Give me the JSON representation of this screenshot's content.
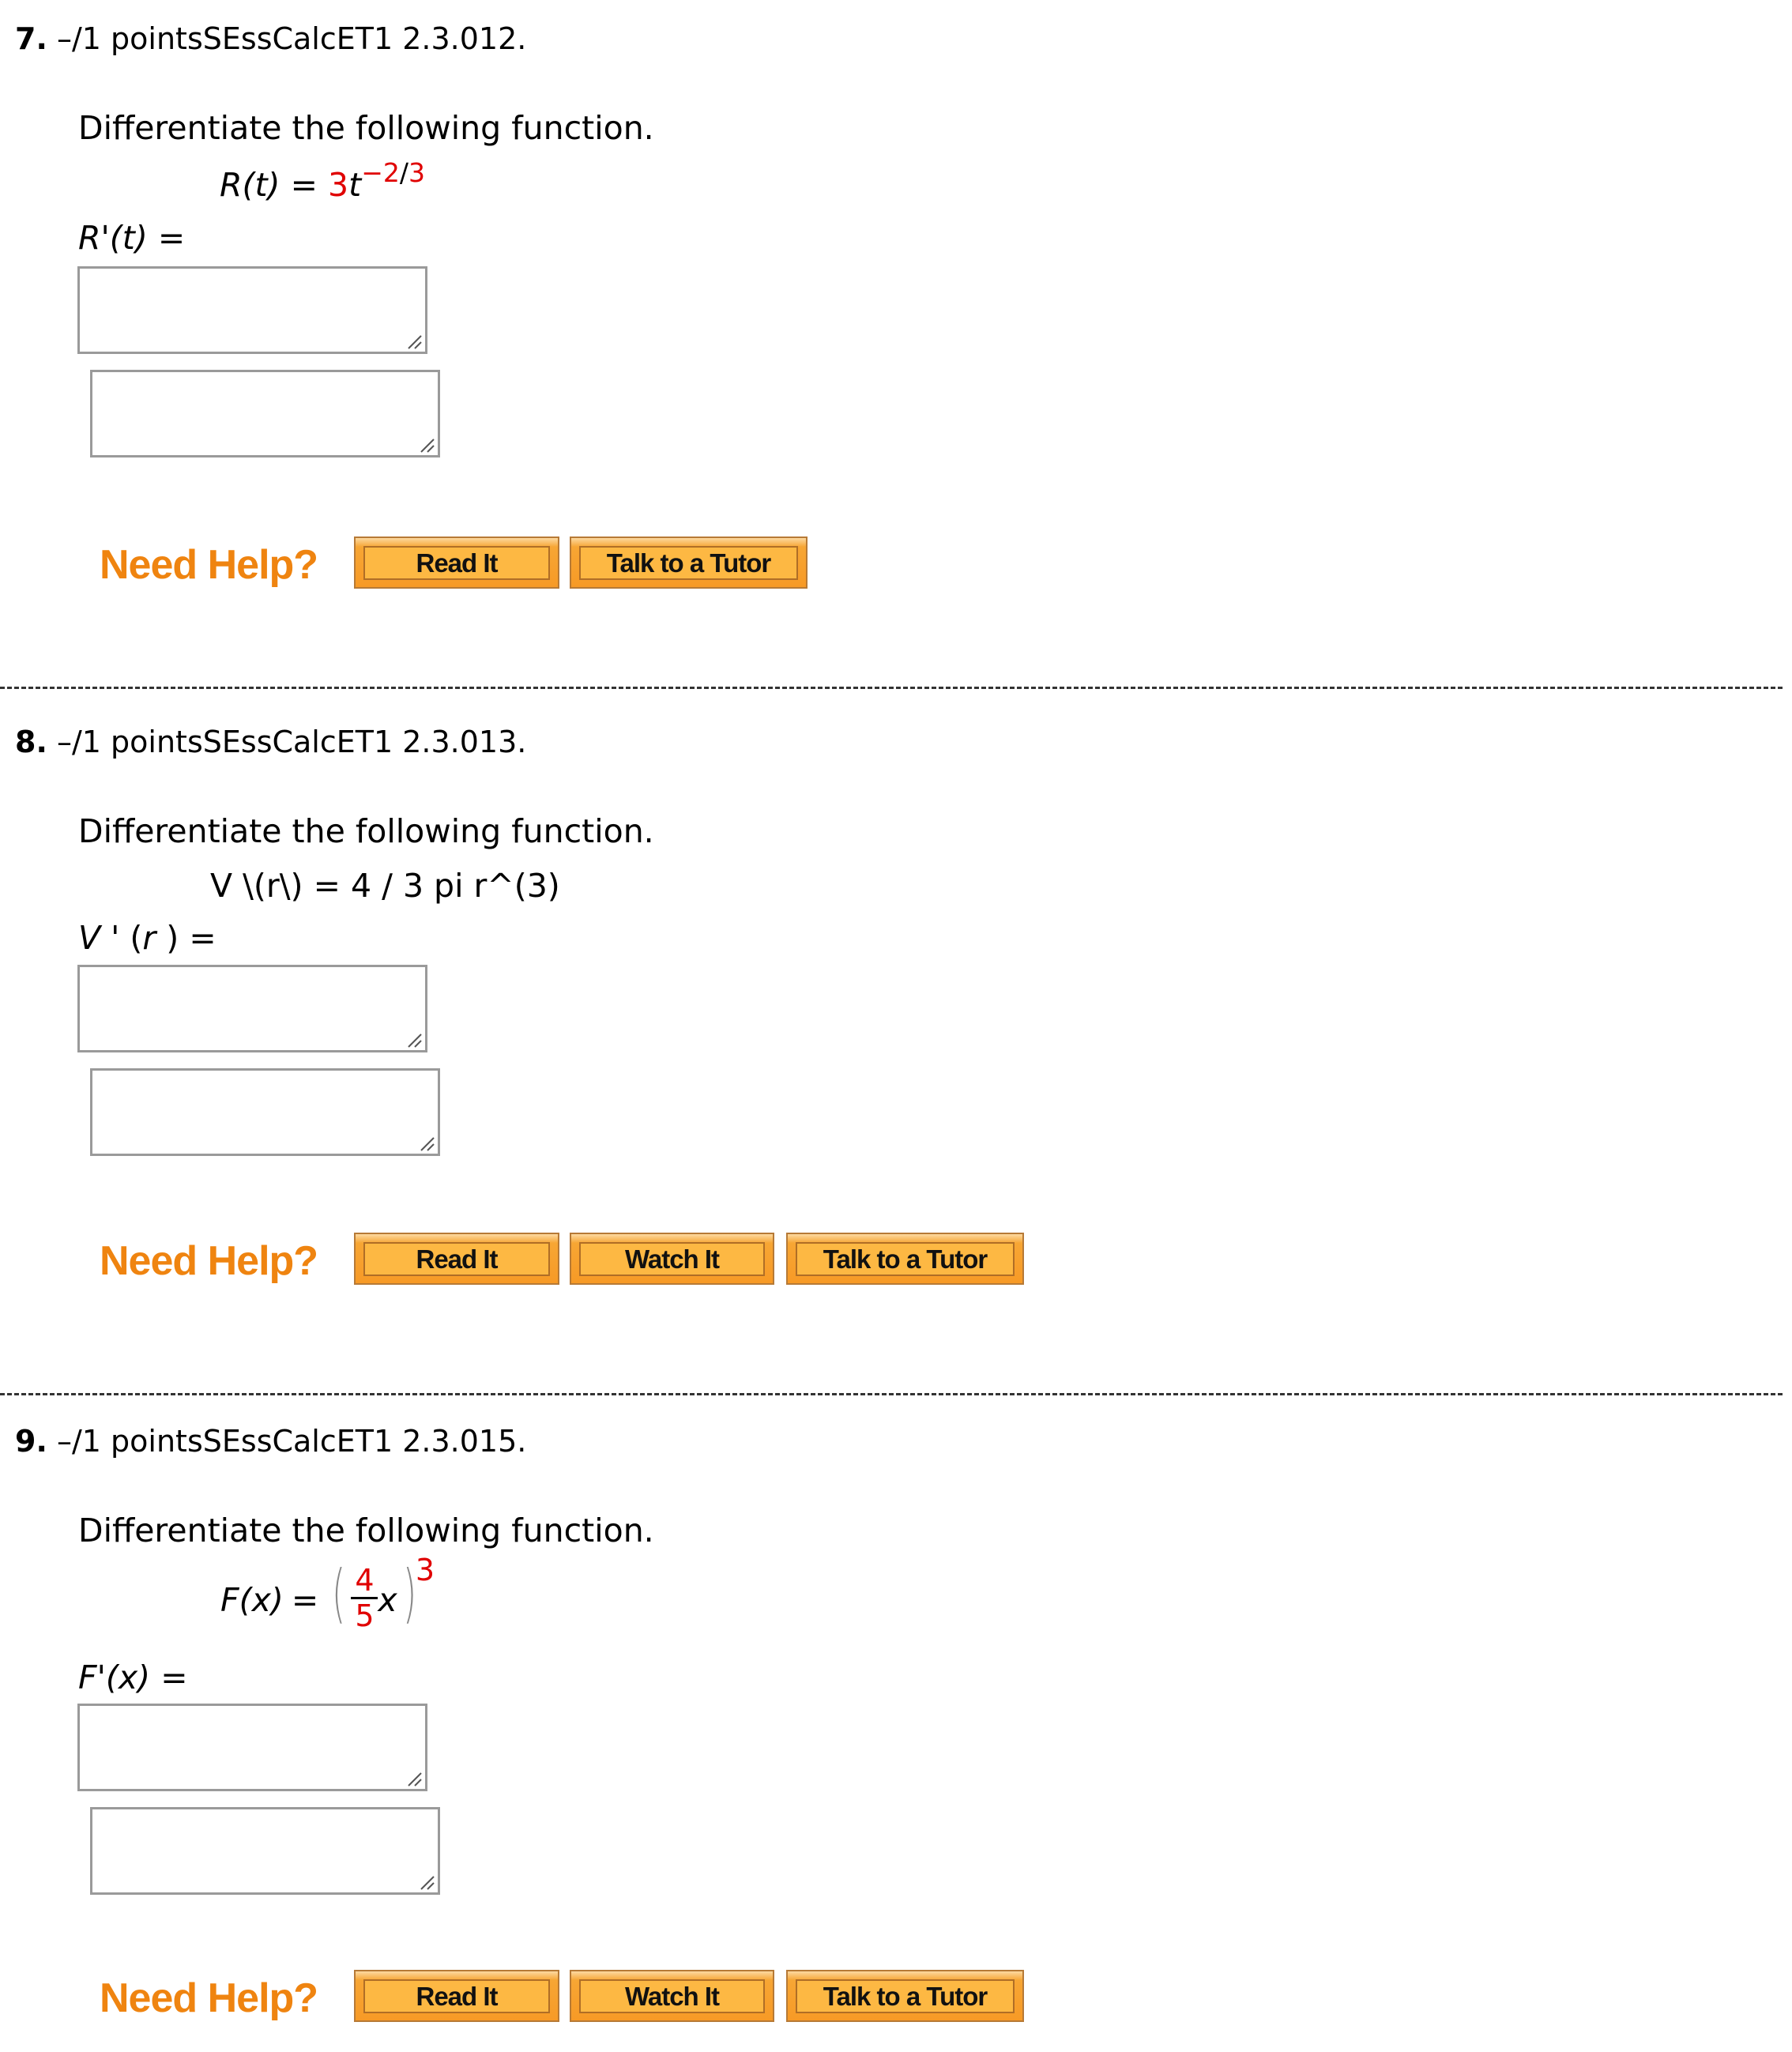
{
  "questions": [
    {
      "number": "7.",
      "points": "–/1 points",
      "code": "SEssCalcET1 2.3.012.",
      "instruction": "Differentiate the following function.",
      "function": {
        "lhs": "R(t)",
        "eq": "=",
        "coef": "3",
        "var": "t",
        "exp_sign": "−",
        "exp_num": "2",
        "exp_slash": "/",
        "exp_den": "3"
      },
      "answer_label": {
        "name": "R",
        "prime": "'",
        "arg": "(t)",
        "eq": "="
      },
      "answer_value": "",
      "work_value": "",
      "help_label": "Need Help?",
      "buttons": [
        "Read It",
        "Talk to a Tutor"
      ]
    },
    {
      "number": "8.",
      "points": "–/1 points",
      "code": "SEssCalcET1 2.3.013.",
      "instruction": "Differentiate the following function.",
      "function_text": "V \\(r\\) = 4 / 3 pi r^(3)",
      "answer_label": {
        "name": "V",
        "prime": " ' ",
        "arg_open": "(",
        "arg": "r",
        "arg_close": " )",
        "eq": "="
      },
      "answer_value": "",
      "work_value": "",
      "help_label": "Need Help?",
      "buttons": [
        "Read It",
        "Watch It",
        "Talk to a Tutor"
      ]
    },
    {
      "number": "9.",
      "points": "–/1 points",
      "code": "SEssCalcET1 2.3.015.",
      "instruction": "Differentiate the following function.",
      "function": {
        "lhs": "F(x)",
        "eq": "=",
        "frac_num": "4",
        "frac_den": "5",
        "var": "x",
        "exponent": "3"
      },
      "answer_label": {
        "name": "F",
        "prime": "'",
        "arg": "(x)",
        "eq": "="
      },
      "answer_value": "",
      "work_value": "",
      "help_label": "Need Help?",
      "buttons": [
        "Read It",
        "Watch It",
        "Talk to a Tutor"
      ]
    }
  ],
  "colors": {
    "accent_red": "#e00000",
    "help_orange": "#ef8410",
    "button_fill": "#fdb843",
    "button_border": "#b77a36"
  }
}
